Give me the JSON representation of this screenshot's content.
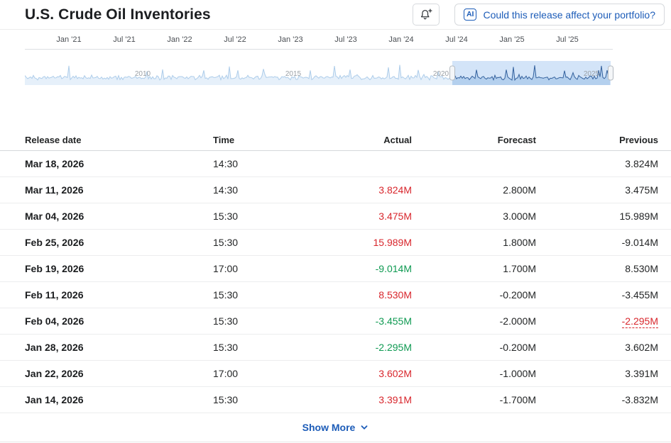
{
  "header": {
    "title": "U.S. Crude Oil Inventories",
    "ai_button": {
      "badge": "AI",
      "label": "Could this release affect your portfolio?"
    },
    "icons": [
      "bell-plus-icon",
      "ai-badge-icon"
    ]
  },
  "chart": {
    "axis_labels": [
      "Jan '21",
      "Jul '21",
      "Jan '22",
      "Jul '22",
      "Jan '23",
      "Jul '23",
      "Jan '24",
      "Jul '24",
      "Jan '25",
      "Jul '25"
    ],
    "navigator_year_labels": [
      "2010",
      "2015",
      "2020",
      "2025"
    ],
    "selection": {
      "start_frac": 0.725,
      "end_frac": 0.994
    }
  },
  "table": {
    "columns": [
      "Release date",
      "Time",
      "Actual",
      "Forecast",
      "Previous"
    ],
    "rows": [
      {
        "date": "Mar 18, 2026",
        "time": "14:30",
        "actual": "",
        "actual_color": "",
        "forecast": "",
        "previous": "3.824M"
      },
      {
        "date": "Mar 11, 2026",
        "time": "14:30",
        "actual": "3.824M",
        "actual_color": "red",
        "forecast": "2.800M",
        "previous": "3.475M"
      },
      {
        "date": "Mar 04, 2026",
        "time": "15:30",
        "actual": "3.475M",
        "actual_color": "red",
        "forecast": "3.000M",
        "previous": "15.989M"
      },
      {
        "date": "Feb 25, 2026",
        "time": "15:30",
        "actual": "15.989M",
        "actual_color": "red",
        "forecast": "1.800M",
        "previous": "-9.014M"
      },
      {
        "date": "Feb 19, 2026",
        "time": "17:00",
        "actual": "-9.014M",
        "actual_color": "green",
        "forecast": "1.700M",
        "previous": "8.530M"
      },
      {
        "date": "Feb 11, 2026",
        "time": "15:30",
        "actual": "8.530M",
        "actual_color": "red",
        "forecast": "-0.200M",
        "previous": "-3.455M"
      },
      {
        "date": "Feb 04, 2026",
        "time": "15:30",
        "actual": "-3.455M",
        "actual_color": "green",
        "forecast": "-2.000M",
        "previous": "-2.295M",
        "previous_color": "red",
        "previous_revised": true
      },
      {
        "date": "Jan 28, 2026",
        "time": "15:30",
        "actual": "-2.295M",
        "actual_color": "green",
        "forecast": "-0.200M",
        "previous": "3.602M"
      },
      {
        "date": "Jan 22, 2026",
        "time": "17:00",
        "actual": "3.602M",
        "actual_color": "red",
        "forecast": "-1.000M",
        "previous": "3.391M"
      },
      {
        "date": "Jan 14, 2026",
        "time": "15:30",
        "actual": "3.391M",
        "actual_color": "red",
        "forecast": "-1.700M",
        "previous": "-3.832M"
      }
    ]
  },
  "footer": {
    "show_more": "Show More",
    "icon": "chevron-down-icon"
  },
  "colors": {
    "accent_blue": "#1c5cb8",
    "negative_red": "#d8262c",
    "positive_green": "#0f9a52",
    "navigator_selection_bg": "#d3e4f8",
    "navigator_line_light": "#aecdea",
    "navigator_area_light": "#e6f0fa",
    "navigator_line_dark": "#35629e",
    "navigator_area_dark": "#b4d0ee"
  }
}
